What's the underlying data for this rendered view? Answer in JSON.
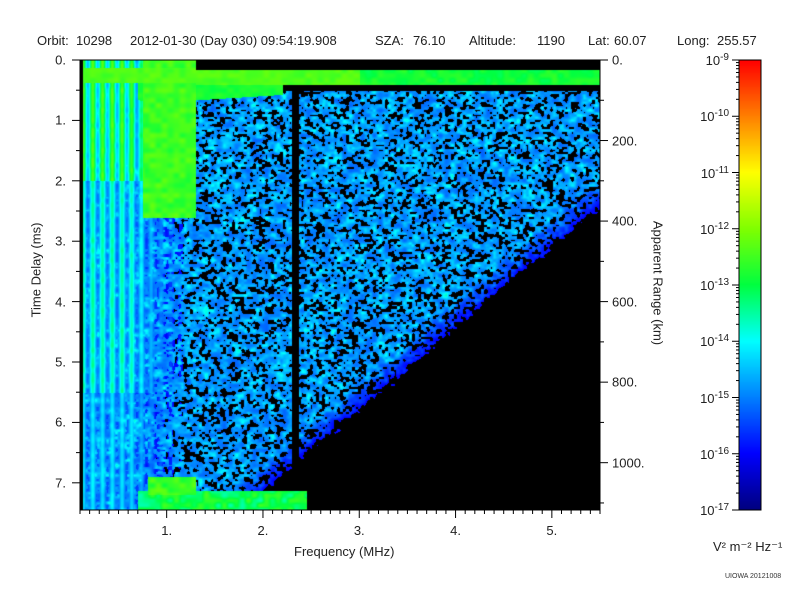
{
  "header": {
    "orbit_label": "Orbit:",
    "orbit": "10298",
    "datetime": "2012-01-30 (Day 030) 09:54:19.908",
    "sza_label": "SZA:",
    "sza": "76.10",
    "altitude_label": "Altitude:",
    "altitude": "1190",
    "lat_label": "Lat:",
    "lat": "60.07",
    "long_label": "Long:",
    "long": "255.57"
  },
  "credit": "UIOWA 20121008",
  "chart_data": {
    "type": "heatmap",
    "title": "",
    "xlabel": "Frequency (MHz)",
    "ylabel": "Time Delay (ms)",
    "y2label": "Apparent Range (km)",
    "xlim": [
      0.1,
      5.5
    ],
    "ylim": [
      0,
      7.45
    ],
    "x_ticks": [
      1,
      2,
      3,
      4,
      5
    ],
    "x_tick_labels": [
      "1.",
      "2.",
      "3.",
      "4.",
      "5."
    ],
    "y_ticks": [
      0,
      1,
      2,
      3,
      4,
      5,
      6,
      7
    ],
    "y_tick_labels": [
      "0.",
      "1.",
      "2.",
      "3.",
      "4.",
      "5.",
      "6.",
      "7."
    ],
    "y2_ticks_km": [
      0,
      200,
      400,
      600,
      800,
      1000
    ],
    "y2_tick_labels": [
      "0.",
      "200.",
      "400.",
      "600.",
      "800.",
      "1000."
    ],
    "km_per_ms": 150,
    "colorbar": {
      "scale": "log",
      "min": 1e-17,
      "max": 1e-09,
      "tick_exponents": [
        -9,
        -10,
        -11,
        -12,
        -13,
        -14,
        -15,
        -16,
        -17
      ],
      "tick_base": "10",
      "unit_label": "V² m⁻² Hz⁻¹",
      "colors": [
        "#00007f",
        "#0000ff",
        "#0080ff",
        "#00ffff",
        "#00ff40",
        "#80ff00",
        "#ffff00",
        "#ff8000",
        "#ff0000"
      ]
    },
    "features": [
      {
        "name": "surface/ionosphere echo trace",
        "x_range": [
          0.1,
          5.5
        ],
        "y_ms": 0.25
      },
      {
        "name": "cutoff line",
        "x": 2.35,
        "y_range": [
          0.3,
          7.4
        ]
      },
      {
        "name": "ground echo trace",
        "x_range": [
          0.7,
          2.4
        ],
        "y_ms": 7.3
      }
    ]
  }
}
